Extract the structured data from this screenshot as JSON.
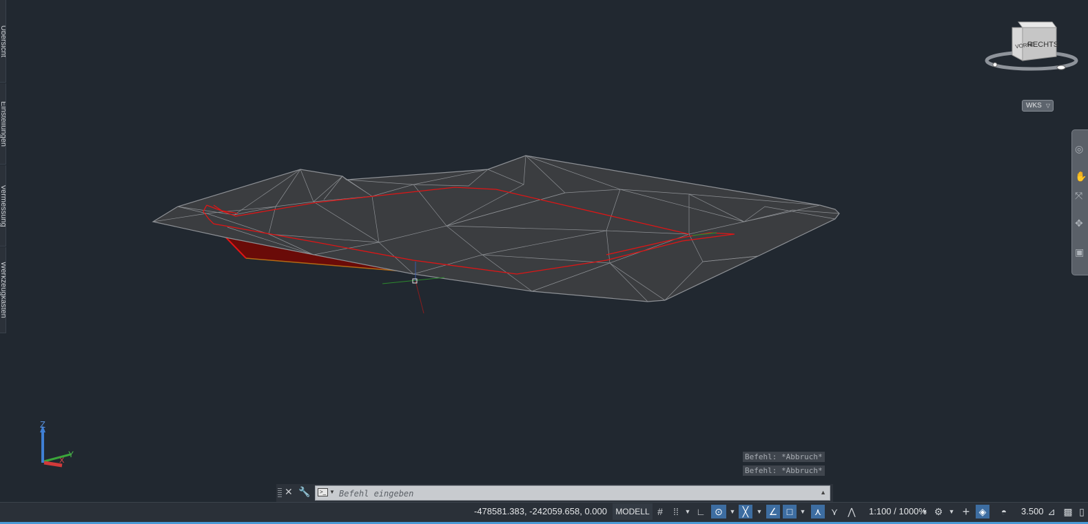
{
  "palette_tabs": [
    {
      "label": "Übersicht"
    },
    {
      "label": "Einstellungen"
    },
    {
      "label": "Vermessung"
    },
    {
      "label": "Werkzeugkasten"
    }
  ],
  "viewcube": {
    "front_label": "VORNE",
    "right_label": "RECHTS"
  },
  "wcs_menu": {
    "label": "WKS"
  },
  "ucs_icon": {
    "z_label": "Z",
    "y_label": "Y",
    "x_label": "X"
  },
  "command_history": [
    "Befehl: *Abbruch*",
    "Befehl: *Abbruch*"
  ],
  "command_line": {
    "placeholder": "Befehl eingeben"
  },
  "status_bar": {
    "coordinates": "-478581.383, -242059.658, 0.000",
    "space": "MODELL",
    "annotation_scale": "1:100 / 1000%",
    "lineweight_value": "3.500"
  },
  "colors": {
    "background": "#212830",
    "surface_fill": "#3b3d40",
    "mesh_line": "#9b9ea2",
    "boundary": "#e01515",
    "accent": "#3d6da1"
  }
}
